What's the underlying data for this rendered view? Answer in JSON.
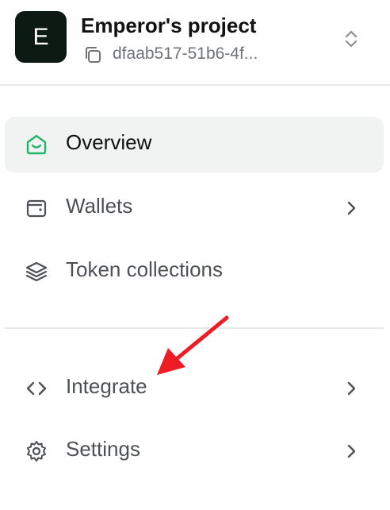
{
  "project": {
    "avatar_letter": "E",
    "name": "Emperor's project",
    "id": "dfaab517-51b6-4f..."
  },
  "nav": {
    "overview": "Overview",
    "wallets": "Wallets",
    "token_collections": "Token collections",
    "integrate": "Integrate",
    "settings": "Settings"
  },
  "colors": {
    "accent": "#22b566",
    "avatar_bg": "#0d1a14",
    "active_bg": "#f1f2f2",
    "annotation_arrow": "#ee1c25"
  },
  "icons": {
    "copy": "copy-icon",
    "switcher": "chevron-up-down-icon",
    "overview": "home-icon",
    "wallets": "wallet-icon",
    "token_collections": "layers-icon",
    "integrate": "code-icon",
    "settings": "gear-icon",
    "chevron": "chevron-right-icon"
  }
}
